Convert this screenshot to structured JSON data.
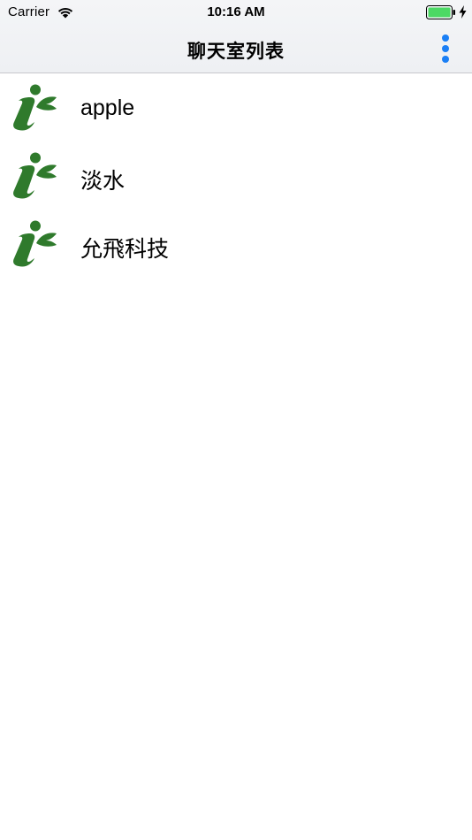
{
  "status_bar": {
    "carrier": "Carrier",
    "time": "10:16 AM",
    "wifi_icon": "wifi-icon",
    "battery_icon": "battery-icon",
    "battery_color": "#4cd964",
    "charging_icon": "bolt-icon"
  },
  "nav_bar": {
    "title": "聊天室列表",
    "more_icon": "more-vertical-icon",
    "accent_color": "#1a7ff5"
  },
  "chat_rooms": [
    {
      "name": "apple",
      "avatar_icon": "leaf-logo-icon"
    },
    {
      "name": "淡水",
      "avatar_icon": "leaf-logo-icon"
    },
    {
      "name": "允飛科技",
      "avatar_icon": "leaf-logo-icon"
    }
  ],
  "logo_color": "#2f7a2c"
}
